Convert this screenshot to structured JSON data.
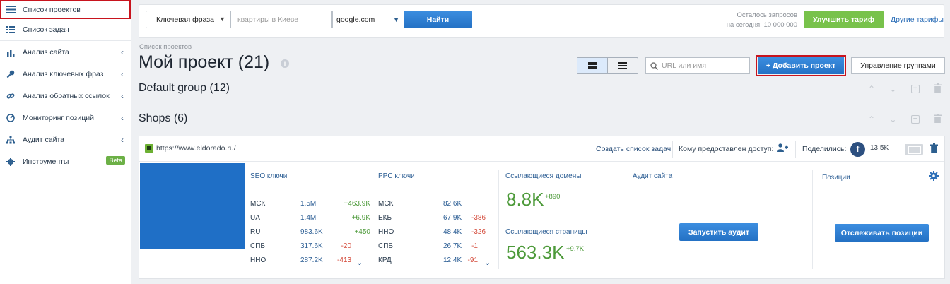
{
  "sidebar": {
    "items": [
      {
        "label": "Список проектов",
        "icon": "list-icon"
      },
      {
        "label": "Список задач",
        "icon": "tasks-icon"
      },
      {
        "label": "Анализ сайта",
        "icon": "chart-icon"
      },
      {
        "label": "Анализ ключевых фраз",
        "icon": "key-icon"
      },
      {
        "label": "Анализ обратных ссылок",
        "icon": "link-icon"
      },
      {
        "label": "Мониторинг позиций",
        "icon": "gauge-icon"
      },
      {
        "label": "Аудит сайта",
        "icon": "sitemap-icon"
      },
      {
        "label": "Инструменты",
        "icon": "gear-icon",
        "badge": "Beta"
      }
    ]
  },
  "topbar": {
    "phrase_select": "Ключевая фраза",
    "query_placeholder": "квартиры в Киеве",
    "engine_select": "google.com",
    "find_label": "Найти",
    "quota_line1": "Осталось запросов",
    "quota_line2": "на сегодня: 10 000 000",
    "upgrade_label": "Улучшить тариф",
    "other_tariffs": "Другие тарифы"
  },
  "header": {
    "breadcrumb": "Список проектов",
    "title": "Мой проект (21)",
    "url_search_placeholder": "URL или имя",
    "add_project": "+ Добавить проект",
    "manage_groups": "Управление группами"
  },
  "groups": [
    {
      "title": "Default group (12)"
    },
    {
      "title": "Shops (6)"
    }
  ],
  "project": {
    "url": "https://www.eldorado.ru/",
    "create_tasks": "Создать список задач",
    "shared_to": "Кому предоставлен доступ:",
    "shared": "Поделились:",
    "fb_letter": "f",
    "fb_count": "13.5K",
    "seo": {
      "title": "SEO ключи",
      "rows": [
        {
          "region": "МСК",
          "value": "1.5M",
          "delta": "+463.9K",
          "sign": "pos"
        },
        {
          "region": "UA",
          "value": "1.4M",
          "delta": "+6.9K",
          "sign": "pos"
        },
        {
          "region": "RU",
          "value": "983.6K",
          "delta": "+450",
          "sign": "pos"
        },
        {
          "region": "СПБ",
          "value": "317.6K",
          "delta": "-20",
          "sign": "neg"
        },
        {
          "region": "ННО",
          "value": "287.2K",
          "delta": "-413",
          "sign": "neg"
        }
      ]
    },
    "ppc": {
      "title": "PPC ключи",
      "rows": [
        {
          "region": "МСК",
          "value": "82.6K",
          "delta": "",
          "sign": "pos"
        },
        {
          "region": "ЕКБ",
          "value": "67.9K",
          "delta": "-386",
          "sign": "neg"
        },
        {
          "region": "ННО",
          "value": "48.4K",
          "delta": "-326",
          "sign": "neg"
        },
        {
          "region": "СПБ",
          "value": "26.7K",
          "delta": "-1",
          "sign": "neg"
        },
        {
          "region": "КРД",
          "value": "12.4K",
          "delta": "-91",
          "sign": "neg"
        }
      ]
    },
    "links": {
      "domains_title": "Ссылающиеся домены",
      "domains_value": "8.8K",
      "domains_delta": "+890",
      "pages_title": "Ссылающиеся страницы",
      "pages_value": "563.3K",
      "pages_delta": "+9.7K"
    },
    "audit": {
      "title": "Аудит сайта",
      "button": "Запустить аудит"
    },
    "positions": {
      "title": "Позиции",
      "button": "Отслеживать позиции"
    }
  }
}
